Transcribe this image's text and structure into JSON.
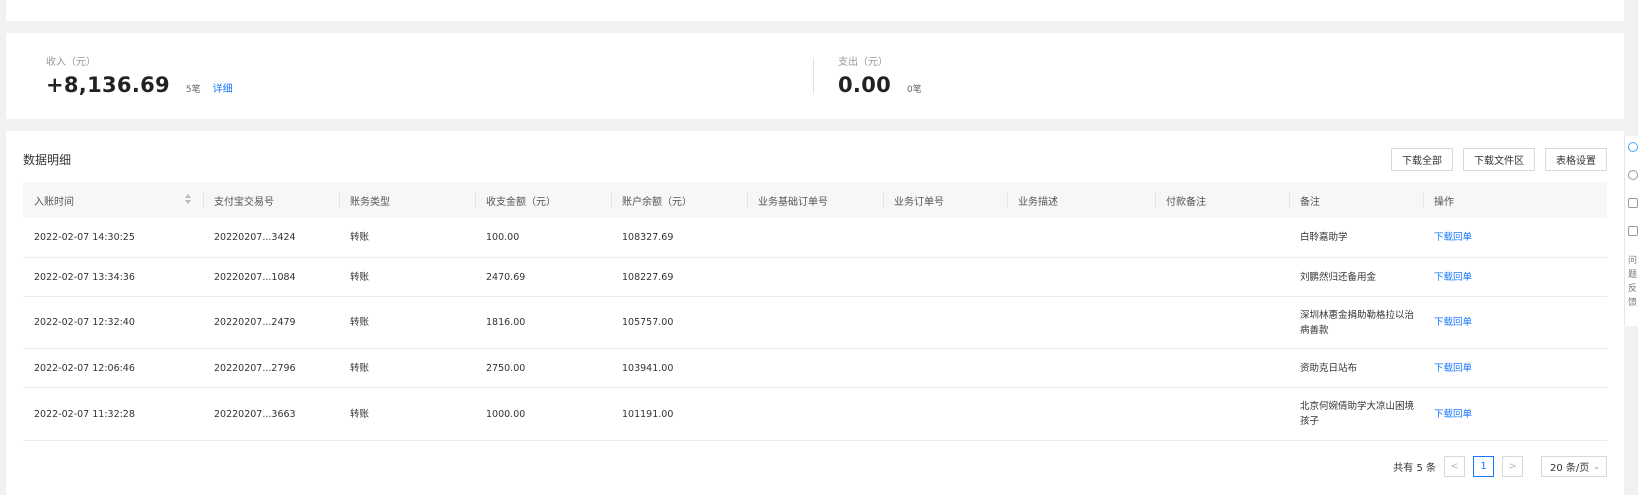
{
  "summary": {
    "income": {
      "label": "收入（元）",
      "amount": "+8,136.69",
      "count": "5笔",
      "detail_link": "详细"
    },
    "expense": {
      "label": "支出（元）",
      "amount": "0.00",
      "count": "0笔"
    }
  },
  "detail": {
    "title": "数据明细",
    "toolbar": {
      "download_all": "下载全部",
      "download_files": "下载文件区",
      "table_settings": "表格设置"
    },
    "columns": [
      "入账时间",
      "支付宝交易号",
      "账务类型",
      "收支金额（元）",
      "账户余额（元）",
      "业务基础订单号",
      "业务订单号",
      "业务描述",
      "付款备注",
      "备注",
      "操作"
    ],
    "rows": [
      {
        "time": "2022-02-07 14:30:25",
        "trade_no": "20220207...3424",
        "type": "转账",
        "amount": "100.00",
        "balance": "108327.69",
        "base_order": "",
        "order": "",
        "desc": "",
        "pay_note": "",
        "note": "白聆嘉助学",
        "action": "下载回单"
      },
      {
        "time": "2022-02-07 13:34:36",
        "trade_no": "20220207...1084",
        "type": "转账",
        "amount": "2470.69",
        "balance": "108227.69",
        "base_order": "",
        "order": "",
        "desc": "",
        "pay_note": "",
        "note": "刘鹏然归还备用金",
        "action": "下载回单"
      },
      {
        "time": "2022-02-07 12:32:40",
        "trade_no": "20220207...2479",
        "type": "转账",
        "amount": "1816.00",
        "balance": "105757.00",
        "base_order": "",
        "order": "",
        "desc": "",
        "pay_note": "",
        "note": "深圳林惠金捐助勒格拉以治病善款",
        "action": "下载回单"
      },
      {
        "time": "2022-02-07 12:06:46",
        "trade_no": "20220207...2796",
        "type": "转账",
        "amount": "2750.00",
        "balance": "103941.00",
        "base_order": "",
        "order": "",
        "desc": "",
        "pay_note": "",
        "note": "资助克日站布",
        "action": "下载回单"
      },
      {
        "time": "2022-02-07 11:32:28",
        "trade_no": "20220207...3663",
        "type": "转账",
        "amount": "1000.00",
        "balance": "101191.00",
        "base_order": "",
        "order": "",
        "desc": "",
        "pay_note": "",
        "note": "北京何婉倩助学大凉山困境孩子",
        "action": "下载回单"
      }
    ],
    "pagination": {
      "total": "共有 5 条",
      "prev": "<",
      "page": "1",
      "next": ">",
      "page_size": "20 条/页"
    }
  },
  "side_rail": {
    "text": "问题反馈"
  }
}
